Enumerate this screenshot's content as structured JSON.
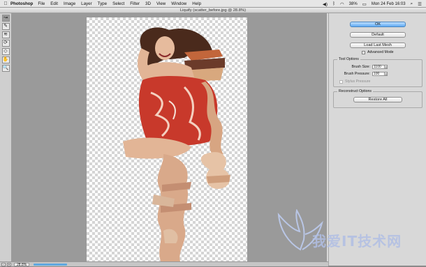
{
  "menubar": {
    "apple": "",
    "app_name": "Photoshop",
    "menus": [
      "File",
      "Edit",
      "Image",
      "Layer",
      "Type",
      "Select",
      "Filter",
      "3D",
      "View",
      "Window",
      "Help"
    ],
    "battery": "38%",
    "clock": "Mon 24 Feb  16:03"
  },
  "window": {
    "title": "Liquify (scatter_before.jpg @ 28.8%)"
  },
  "tools": [
    "forward-warp",
    "reconstruct",
    "smooth",
    "twirl",
    "pucker",
    "hand",
    "zoom"
  ],
  "tool_glyphs": [
    "↝",
    "✎",
    "≋",
    "⟳",
    "◇",
    "✋",
    "🔍"
  ],
  "panel": {
    "ok_label": "OK",
    "default_label": "Default",
    "load_last_mesh_label": "Load Last Mesh",
    "advanced_mode_label": "Advanced Mode",
    "tool_options_title": "Tool Options",
    "brush_size_label": "Brush Size:",
    "brush_size_value": "1100",
    "brush_pressure_label": "Brush Pressure:",
    "brush_pressure_value": "100",
    "stylus_pressure_label": "Stylus Pressure",
    "reconstruct_options_title": "Reconstruct Options",
    "restore_all_label": "Restore All"
  },
  "statusbar": {
    "zoom_out": "−",
    "zoom_in": "+",
    "zoom_value": "28.8%"
  },
  "watermark": "我爱IT技术网",
  "colors": {
    "accent": "#5ea9f2",
    "dress_red": "#c8392b",
    "skin": "#e2b596",
    "hair": "#4a2a1c"
  }
}
